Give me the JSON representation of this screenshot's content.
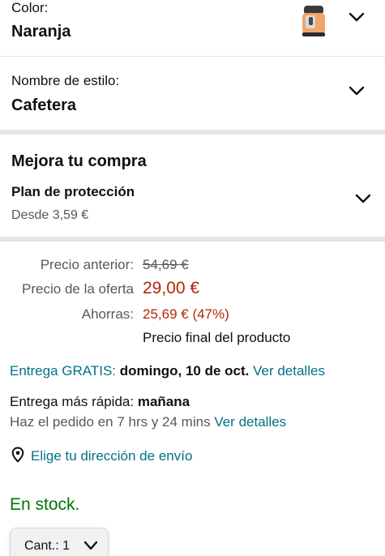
{
  "color": {
    "label": "Color:",
    "value": "Naranja",
    "thumbnail": "coffee-machine-thumbnail"
  },
  "style": {
    "label": "Nombre de estilo:",
    "value": "Cafetera"
  },
  "upsell": {
    "title": "Mejora tu compra",
    "plan": "Plan de protección",
    "from": "Desde 3,59 €"
  },
  "pricing": {
    "list_label": "Precio anterior:",
    "list_value": "54,69 €",
    "deal_label": "Precio de la oferta",
    "deal_value": "29,00 €",
    "save_label": "Ahorras:",
    "save_value": "25,69 € (47%)",
    "final_note": "Precio final del producto"
  },
  "delivery": {
    "free_label": "Entrega GRATIS:",
    "free_date": "domingo, 10 de oct.",
    "details_link": "Ver detalles",
    "fast_label": "Entrega más rápida:",
    "fast_date": "mañana",
    "order_within": "Haz el pedido en 7 hrs y 24 mins",
    "fast_details_link": "Ver detalles"
  },
  "address_link": "Elige tu dirección de envío",
  "stock": "En stock.",
  "quantity": {
    "label": "Cant.:",
    "value": "1"
  },
  "colors": {
    "text": "#0f1111",
    "muted": "#565959",
    "link": "#007185",
    "price": "#b12704",
    "stock": "#007600"
  }
}
